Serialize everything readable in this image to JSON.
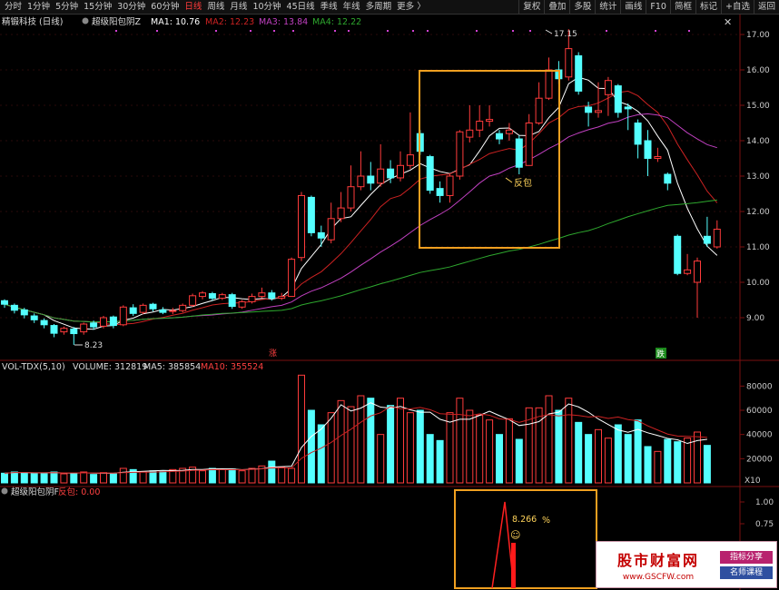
{
  "toolbar": {
    "timeframes": [
      "分时",
      "1分钟",
      "5分钟",
      "15分钟",
      "30分钟",
      "60分钟",
      "日线",
      "周线",
      "月线",
      "10分钟",
      "45日线",
      "季线",
      "年线",
      "多周期",
      "更多 〉"
    ],
    "active_timeframe": "日线",
    "tools": [
      "复权",
      "叠加",
      "多股",
      "统计",
      "画线",
      "F10",
      "简框",
      "标记",
      "+自选",
      "返回"
    ]
  },
  "price_legend": {
    "stock": "精锻科技 (日线)",
    "indicator": "超级阳包阴Z",
    "ma1": "MA1: 10.76",
    "ma2": "MA2: 12.23",
    "ma3": "MA3: 13.84",
    "ma4": "MA4: 12.22"
  },
  "volume_legend": {
    "name": "VOL-TDX(5,10)",
    "volume": "VOLUME: 312819",
    "ma5": "MA5: 385854",
    "ma10": "MA10: 355524"
  },
  "indicator_legend": {
    "name": "超级阳包阴F",
    "value": "反包: 0.00"
  },
  "annotations": {
    "high": "17.15",
    "low": "8.23",
    "fanbao": "反包",
    "zhang": "涨",
    "die": "跌",
    "pct_value": "8.266",
    "pct_unit": "%",
    "smile": "☺"
  },
  "price_axis": [
    "17.00",
    "16.00",
    "15.00",
    "14.00",
    "13.00",
    "12.00",
    "11.00",
    "10.00",
    "9.00"
  ],
  "volume_axis": [
    "80000",
    "60000",
    "40000",
    "20000"
  ],
  "volume_unit": "X10",
  "indicator_axis": [
    "1.00",
    "0.75"
  ],
  "colors": {
    "up": "#ff3b3b",
    "down": "#54ffff",
    "ma1": "#ffffff",
    "ma2": "#cc2222",
    "ma3": "#c040c0",
    "ma4": "#2ea82e",
    "highlight": "#f0a020"
  },
  "chart_data": {
    "type": "candlestick",
    "price_candles": [
      [
        9.48,
        9.38,
        9.52,
        9.28
      ],
      [
        9.35,
        9.21,
        9.4,
        9.12
      ],
      [
        9.22,
        9.08,
        9.28,
        8.98
      ],
      [
        9.05,
        8.94,
        9.12,
        8.85
      ],
      [
        8.92,
        8.8,
        8.98,
        8.7
      ],
      [
        8.78,
        8.56,
        8.82,
        8.45
      ],
      [
        8.6,
        8.7,
        8.75,
        8.52
      ],
      [
        8.68,
        8.55,
        8.74,
        8.23
      ],
      [
        8.6,
        8.82,
        8.86,
        8.52
      ],
      [
        8.85,
        8.74,
        8.92,
        8.66
      ],
      [
        8.76,
        9.0,
        9.05,
        8.7
      ],
      [
        9.02,
        8.78,
        9.06,
        8.7
      ],
      [
        8.8,
        9.3,
        9.35,
        8.76
      ],
      [
        9.28,
        9.12,
        9.38,
        9.05
      ],
      [
        9.15,
        9.35,
        9.4,
        9.1
      ],
      [
        9.38,
        9.25,
        9.42,
        9.18
      ],
      [
        9.22,
        9.15,
        9.3,
        9.1
      ],
      [
        9.18,
        9.2,
        9.28,
        9.1
      ],
      [
        9.2,
        9.35,
        9.4,
        9.15
      ],
      [
        9.35,
        9.62,
        9.68,
        9.3
      ],
      [
        9.6,
        9.7,
        9.75,
        9.52
      ],
      [
        9.68,
        9.55,
        9.73,
        9.48
      ],
      [
        9.55,
        9.65,
        9.7,
        9.5
      ],
      [
        9.65,
        9.32,
        9.7,
        9.25
      ],
      [
        9.3,
        9.45,
        9.5,
        9.25
      ],
      [
        9.45,
        9.6,
        9.68,
        9.4
      ],
      [
        9.6,
        9.7,
        9.85,
        9.55
      ],
      [
        9.7,
        9.55,
        9.78,
        9.48
      ],
      [
        9.55,
        9.6,
        9.7,
        9.5
      ],
      [
        9.6,
        10.65,
        10.7,
        9.6
      ],
      [
        10.7,
        12.45,
        12.55,
        10.6
      ],
      [
        12.4,
        11.4,
        12.45,
        11.3
      ],
      [
        11.4,
        11.25,
        11.6,
        11.0
      ],
      [
        11.2,
        11.8,
        12.25,
        11.1
      ],
      [
        11.8,
        12.1,
        12.55,
        11.7
      ],
      [
        12.1,
        12.7,
        13.3,
        12.0
      ],
      [
        12.7,
        13.0,
        13.7,
        12.6
      ],
      [
        13.0,
        12.8,
        13.4,
        12.6
      ],
      [
        12.8,
        13.2,
        13.9,
        12.7
      ],
      [
        13.2,
        12.95,
        13.45,
        12.8
      ],
      [
        12.95,
        13.3,
        13.7,
        12.85
      ],
      [
        13.3,
        13.6,
        14.8,
        13.2
      ],
      [
        14.2,
        13.7,
        14.3,
        13.6
      ],
      [
        13.55,
        12.6,
        13.6,
        12.5
      ],
      [
        12.65,
        12.45,
        12.85,
        12.25
      ],
      [
        12.45,
        13.0,
        13.05,
        12.25
      ],
      [
        13.0,
        14.25,
        14.3,
        12.9
      ],
      [
        14.1,
        14.3,
        15.0,
        13.95
      ],
      [
        14.3,
        14.55,
        15.0,
        14.1
      ],
      [
        14.55,
        14.6,
        15.0,
        14.4
      ],
      [
        14.2,
        14.05,
        14.3,
        13.9
      ],
      [
        14.2,
        14.3,
        14.5,
        14.0
      ],
      [
        14.05,
        13.25,
        14.15,
        13.05
      ],
      [
        13.3,
        14.5,
        14.75,
        13.3
      ],
      [
        14.5,
        15.2,
        15.65,
        14.45
      ],
      [
        15.2,
        16.0,
        16.35,
        15.15
      ],
      [
        16.0,
        15.75,
        16.25,
        15.6
      ],
      [
        15.8,
        16.6,
        17.15,
        15.7
      ],
      [
        16.4,
        15.4,
        16.5,
        15.3
      ],
      [
        14.95,
        14.8,
        15.1,
        14.4
      ],
      [
        14.8,
        14.85,
        15.65,
        14.65
      ],
      [
        15.3,
        15.7,
        15.8,
        14.7
      ],
      [
        15.55,
        14.8,
        15.6,
        14.65
      ],
      [
        14.95,
        14.9,
        15.05,
        14.3
      ],
      [
        14.5,
        13.9,
        14.6,
        13.5
      ],
      [
        14.0,
        13.5,
        14.3,
        13.0
      ],
      [
        13.5,
        13.55,
        13.8,
        13.4
      ],
      [
        13.05,
        12.8,
        13.1,
        12.6
      ],
      [
        11.3,
        10.25,
        11.35,
        10.2
      ],
      [
        10.25,
        10.35,
        10.8,
        10.2
      ],
      [
        10.0,
        10.6,
        10.7,
        9.0
      ],
      [
        11.3,
        11.1,
        11.85,
        11.0
      ],
      [
        11.0,
        11.5,
        11.75,
        10.95
      ]
    ],
    "volumes": [
      8000,
      9000,
      8500,
      8000,
      8000,
      9000,
      7500,
      8000,
      9000,
      7000,
      8500,
      7500,
      12000,
      11000,
      9000,
      10000,
      9500,
      11000,
      12000,
      13000,
      10000,
      12000,
      11000,
      11500,
      10000,
      12000,
      14000,
      18000,
      13000,
      12000,
      89000,
      60000,
      48000,
      58000,
      68000,
      63000,
      72000,
      70000,
      40000,
      64000,
      70000,
      58000,
      60000,
      40000,
      35000,
      58000,
      70000,
      60000,
      56000,
      52000,
      40000,
      53000,
      36000,
      62000,
      62000,
      72000,
      60000,
      70000,
      50000,
      40000,
      44000,
      37000,
      48000,
      40000,
      52000,
      30000,
      26000,
      36000,
      34000,
      37000,
      42000,
      31000
    ],
    "indicator_peak": {
      "value": 1.0,
      "label": "8.266"
    }
  }
}
